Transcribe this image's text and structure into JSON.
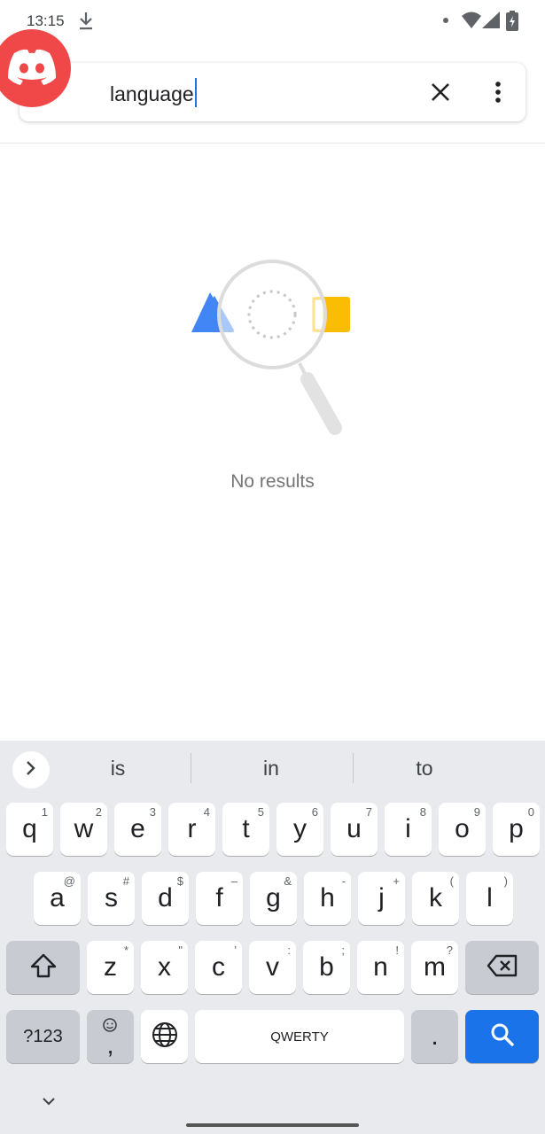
{
  "status_bar": {
    "time": "13:15",
    "icons": [
      "download-icon",
      "notification-dot",
      "wifi-icon",
      "signal-icon",
      "battery-charging-icon"
    ]
  },
  "search": {
    "query": "language",
    "clear_icon": "close-icon",
    "menu_icon": "more-vert-icon",
    "app_icon": "discord-logo"
  },
  "empty_state": {
    "message": "No results",
    "illustration": "magnifier-search-illustration"
  },
  "keyboard": {
    "suggestions": [
      "is",
      "in",
      "to"
    ],
    "row1": [
      {
        "key": "q",
        "hint": "1"
      },
      {
        "key": "w",
        "hint": "2"
      },
      {
        "key": "e",
        "hint": "3"
      },
      {
        "key": "r",
        "hint": "4"
      },
      {
        "key": "t",
        "hint": "5"
      },
      {
        "key": "y",
        "hint": "6"
      },
      {
        "key": "u",
        "hint": "7"
      },
      {
        "key": "i",
        "hint": "8"
      },
      {
        "key": "o",
        "hint": "9"
      },
      {
        "key": "p",
        "hint": "0"
      }
    ],
    "row2": [
      {
        "key": "a",
        "hint": "@"
      },
      {
        "key": "s",
        "hint": "#"
      },
      {
        "key": "d",
        "hint": "$"
      },
      {
        "key": "f",
        "hint": "–"
      },
      {
        "key": "g",
        "hint": "&"
      },
      {
        "key": "h",
        "hint": "-"
      },
      {
        "key": "j",
        "hint": "+"
      },
      {
        "key": "k",
        "hint": "("
      },
      {
        "key": "l",
        "hint": ")"
      }
    ],
    "row3": [
      {
        "key": "z",
        "hint": "*"
      },
      {
        "key": "x",
        "hint": "\""
      },
      {
        "key": "c",
        "hint": "'"
      },
      {
        "key": "v",
        "hint": ":"
      },
      {
        "key": "b",
        "hint": ";"
      },
      {
        "key": "n",
        "hint": "!"
      },
      {
        "key": "m",
        "hint": "?"
      }
    ],
    "symbols_label": "?123",
    "comma": ",",
    "space_label": "QWERTY",
    "period": ".",
    "colors": {
      "accent": "#1a73e8",
      "background": "#e8eaed",
      "special_key": "#c8ccd2"
    }
  }
}
